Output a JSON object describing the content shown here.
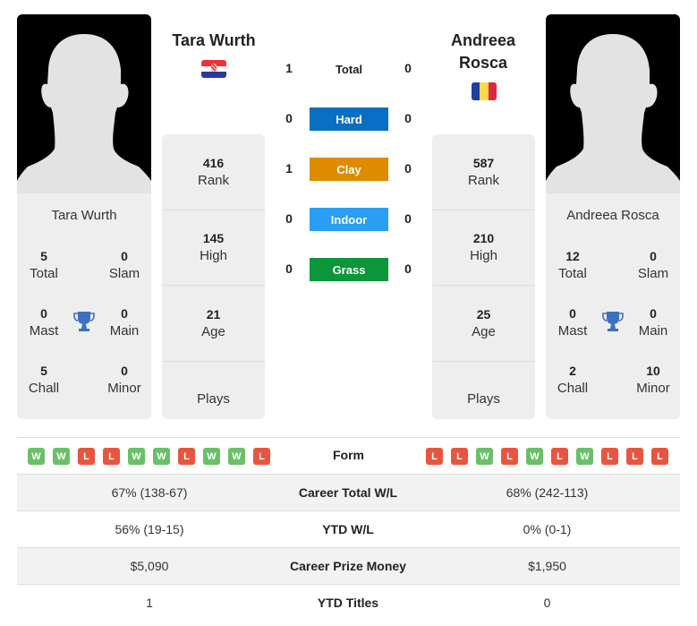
{
  "player1": {
    "name": "Tara Wurth",
    "country_flag": "croatia-flag",
    "rank": "416",
    "rank_label": "Rank",
    "high": "145",
    "high_label": "High",
    "age": "21",
    "age_label": "Age",
    "plays_label": "Plays",
    "titles": {
      "total": "5",
      "total_label": "Total",
      "slam": "0",
      "slam_label": "Slam",
      "mast": "0",
      "mast_label": "Mast",
      "main": "0",
      "main_label": "Main",
      "chall": "5",
      "chall_label": "Chall",
      "minor": "0",
      "minor_label": "Minor"
    },
    "form": [
      "W",
      "W",
      "L",
      "L",
      "W",
      "W",
      "L",
      "W",
      "W",
      "L"
    ]
  },
  "player2": {
    "name": "Andreea Rosca",
    "name_line1": "Andreea",
    "name_line2": "Rosca",
    "country_flag": "romania-flag",
    "rank": "587",
    "rank_label": "Rank",
    "high": "210",
    "high_label": "High",
    "age": "25",
    "age_label": "Age",
    "plays_label": "Plays",
    "titles": {
      "total": "12",
      "total_label": "Total",
      "slam": "0",
      "slam_label": "Slam",
      "mast": "0",
      "mast_label": "Mast",
      "main": "0",
      "main_label": "Main",
      "chall": "2",
      "chall_label": "Chall",
      "minor": "10",
      "minor_label": "Minor"
    },
    "form": [
      "L",
      "L",
      "W",
      "L",
      "W",
      "L",
      "W",
      "L",
      "L",
      "L"
    ]
  },
  "h2h": {
    "total": {
      "label": "Total",
      "p1": "1",
      "p2": "0"
    },
    "surfaces": [
      {
        "label": "Hard",
        "p1": "0",
        "p2": "0",
        "color": "#0a6fc2"
      },
      {
        "label": "Clay",
        "p1": "1",
        "p2": "0",
        "color": "#dd8c00"
      },
      {
        "label": "Indoor",
        "p1": "0",
        "p2": "0",
        "color": "#2a9df4"
      },
      {
        "label": "Grass",
        "p1": "0",
        "p2": "0",
        "color": "#0a9639"
      }
    ]
  },
  "form_label": "Form",
  "comparison": [
    {
      "label": "Career Total W/L",
      "p1": "67% (138-67)",
      "p2": "68% (242-113)"
    },
    {
      "label": "YTD W/L",
      "p1": "56% (19-15)",
      "p2": "0% (0-1)"
    },
    {
      "label": "Career Prize Money",
      "p1": "$5,090",
      "p2": "$1,950"
    },
    {
      "label": "YTD Titles",
      "p1": "1",
      "p2": "0"
    }
  ],
  "colors": {
    "win": "#6abf69",
    "loss": "#e8553e",
    "trophy": "#3b72c0"
  }
}
